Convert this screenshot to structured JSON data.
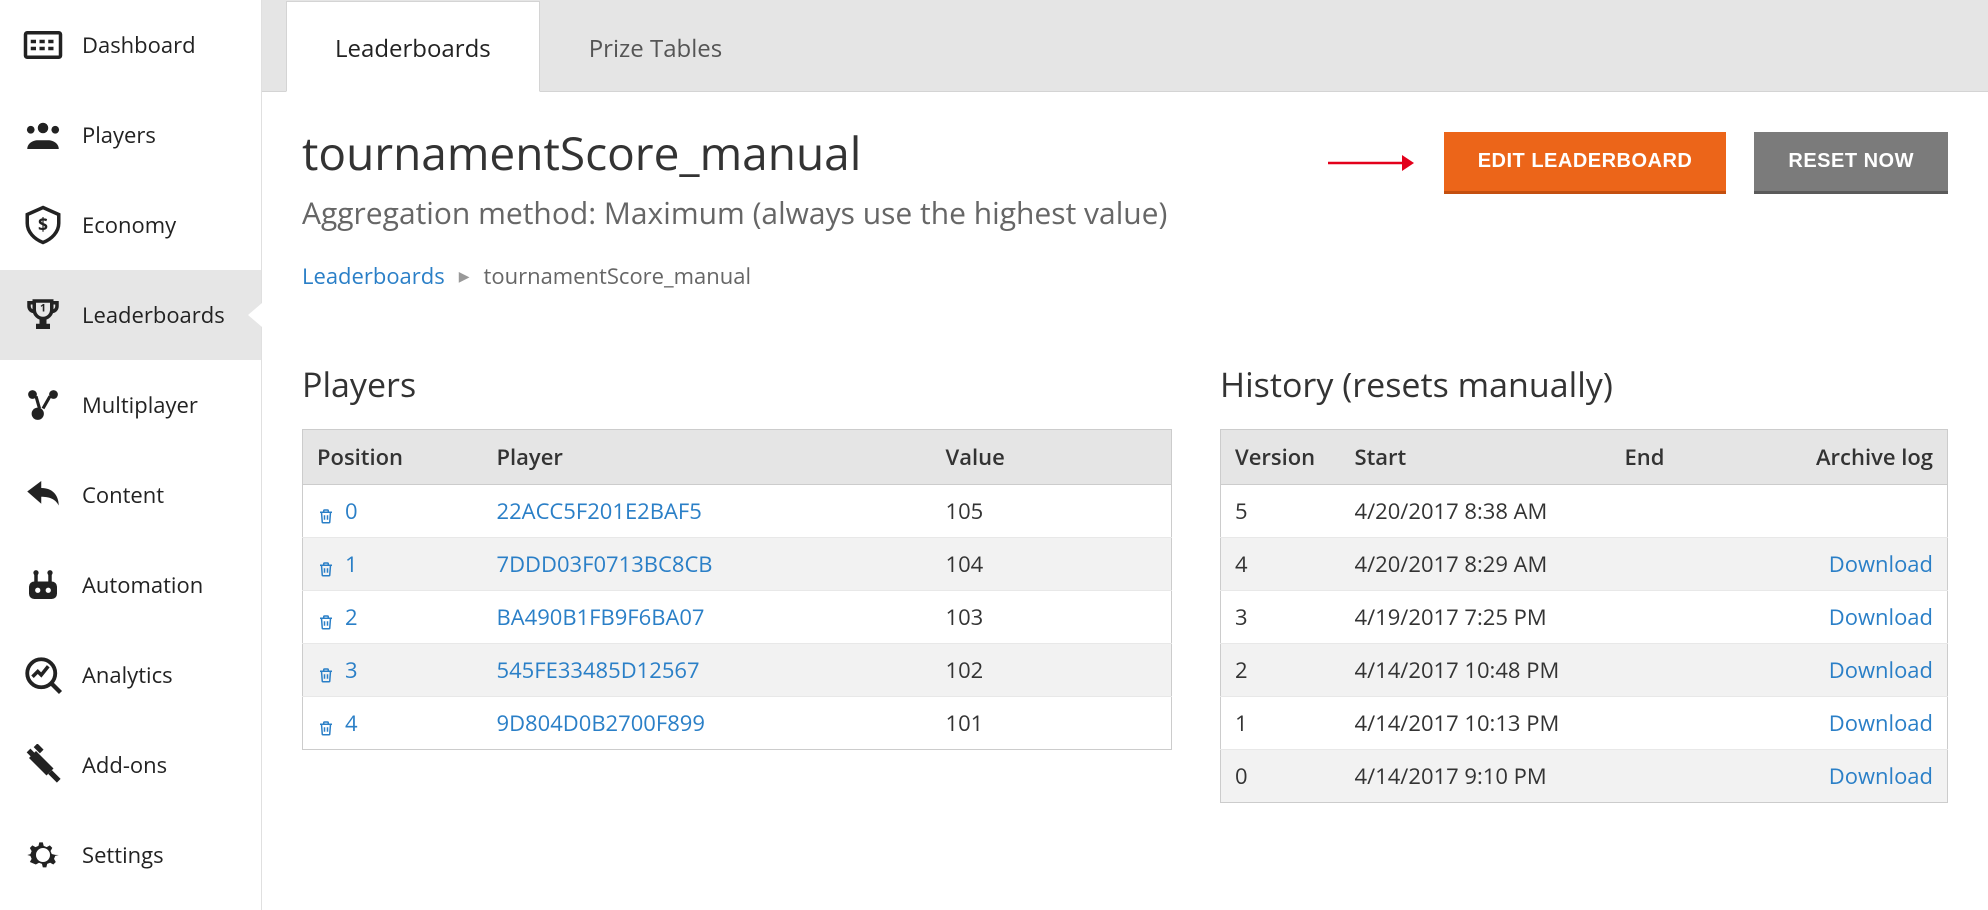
{
  "sidebar": {
    "items": [
      {
        "label": "Dashboard"
      },
      {
        "label": "Players"
      },
      {
        "label": "Economy"
      },
      {
        "label": "Leaderboards"
      },
      {
        "label": "Multiplayer"
      },
      {
        "label": "Content"
      },
      {
        "label": "Automation"
      },
      {
        "label": "Analytics"
      },
      {
        "label": "Add-ons"
      },
      {
        "label": "Settings"
      }
    ]
  },
  "tabs": {
    "leaderboards": "Leaderboards",
    "prize_tables": "Prize Tables"
  },
  "header": {
    "title": "tournamentScore_manual",
    "subtitle": "Aggregation method: Maximum (always use the highest value)",
    "edit_btn": "EDIT LEADERBOARD",
    "reset_btn": "RESET NOW"
  },
  "breadcrumb": {
    "root": "Leaderboards",
    "current": "tournamentScore_manual"
  },
  "players_panel": {
    "title": "Players",
    "columns": {
      "position": "Position",
      "player": "Player",
      "value": "Value"
    },
    "rows": [
      {
        "position": "0",
        "player": "22ACC5F201E2BAF5",
        "value": "105"
      },
      {
        "position": "1",
        "player": "7DDD03F0713BC8CB",
        "value": "104"
      },
      {
        "position": "2",
        "player": "BA490B1FB9F6BA07",
        "value": "103"
      },
      {
        "position": "3",
        "player": "545FE33485D12567",
        "value": "102"
      },
      {
        "position": "4",
        "player": "9D804D0B2700F899",
        "value": "101"
      }
    ]
  },
  "history_panel": {
    "title": "History (resets manually)",
    "columns": {
      "version": "Version",
      "start": "Start",
      "end": "End",
      "archive": "Archive log"
    },
    "download_label": "Download",
    "rows": [
      {
        "version": "5",
        "start": "4/20/2017 8:38 AM",
        "end": "",
        "download": false
      },
      {
        "version": "4",
        "start": "4/20/2017 8:29 AM",
        "end": "",
        "download": true
      },
      {
        "version": "3",
        "start": "4/19/2017 7:25 PM",
        "end": "",
        "download": true
      },
      {
        "version": "2",
        "start": "4/14/2017 10:48 PM",
        "end": "",
        "download": true
      },
      {
        "version": "1",
        "start": "4/14/2017 10:13 PM",
        "end": "",
        "download": true
      },
      {
        "version": "0",
        "start": "4/14/2017 9:10 PM",
        "end": "",
        "download": true
      }
    ]
  }
}
